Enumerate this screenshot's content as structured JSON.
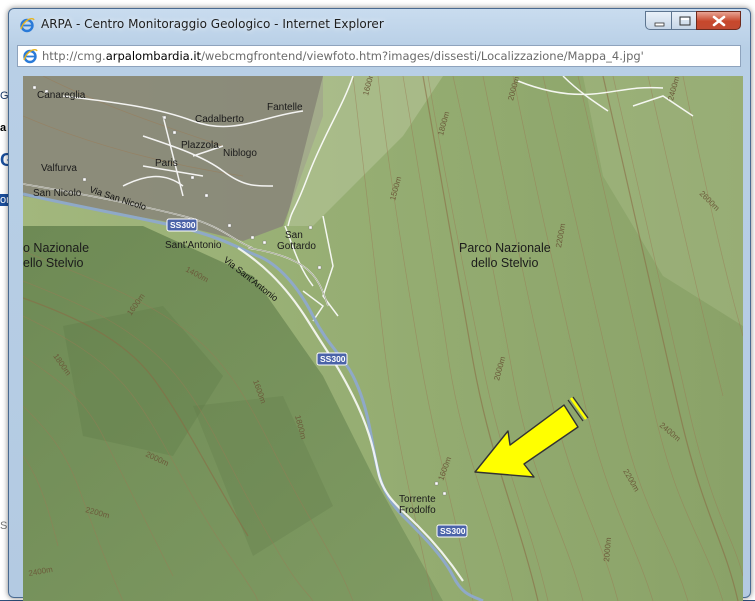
{
  "window": {
    "title": "ARPA - Centro Monitoraggio Geologico - Internet Explorer",
    "url_prefix": "http://cmg.",
    "url_domain": "arpalombardia.it",
    "url_path": "/webcmgfrontend/viewfoto.htm?images/dissesti/Localizzazione/Mappa_4.jpg'"
  },
  "map": {
    "places": {
      "canareglia": "Canareglia",
      "fantelle": "Fantelle",
      "cadalberto": "Cadalberto",
      "plazzola": "Plazzola",
      "niblogo": "Niblogo",
      "paris": "Paris",
      "valfurva": "Valfurva",
      "san_nicolo": "San Nicolo",
      "sant_antonio": "Sant'Antonio",
      "san": "San",
      "gottardo": "Gottardo",
      "torrente": "Torrente",
      "frodolfo": "Frodolfo"
    },
    "park_left_1": "o Nazionale",
    "park_left_2": "ello Stelvio",
    "park_right_1": "Parco Nazionale",
    "park_right_2": "dello Stelvio",
    "roads": {
      "via_san_nicolo": "Via San Nicolo",
      "via_sant_antonio": "Via Sant'Antonio"
    },
    "shields": [
      "SS300",
      "SS300",
      "SS300"
    ],
    "elevations": {
      "e1600_top": "1600m",
      "e1800_top": "1800m",
      "e2000_top": "2000m",
      "e2400_top": "2400m",
      "e2600_right": "2600m",
      "e2200_center": "2200m",
      "e1400_left": "1400m",
      "e1600_left": "1600m",
      "e1800_left": "1800m",
      "e1600_mid": "1600m",
      "e1800_mid": "1800m",
      "e2000_mid": "2000m",
      "e1600_center": "1600m",
      "e2000_bottom": "2000m",
      "e2200_bottom": "2200m",
      "e2400_corner": "2400m",
      "e2000_right": "2000m",
      "e2200_right": "2200m",
      "e2400_right": "2400m",
      "e1500_top": "1500m"
    }
  },
  "background_page": {
    "frag1": "Ge",
    "frag2": "a",
    "frag3": "G",
    "frag4": "or",
    "frag5": "SC"
  },
  "colors": {
    "arrow_fill": "#ffff00",
    "arrow_stroke": "#333333",
    "shield_blue": "#4b63a8",
    "river": "#8fa9c8",
    "map_green": "#8da56a"
  }
}
